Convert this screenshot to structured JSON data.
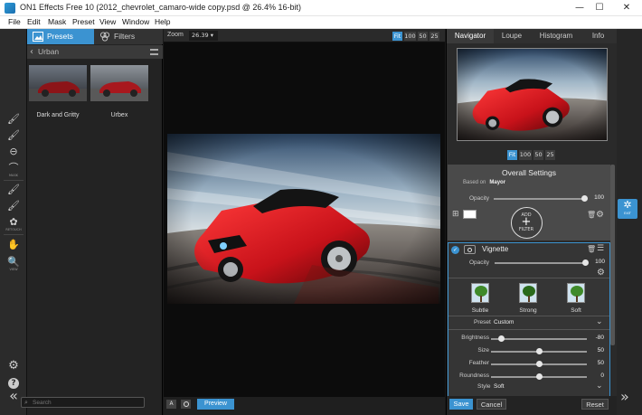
{
  "window": {
    "title": "ON1 Effects Free 10 (2012_chevrolet_camaro-wide copy.psd @ 26.4% 16-bit)",
    "minimize": "—",
    "maximize": "☐",
    "close": "✕"
  },
  "menu": [
    "File",
    "Edit",
    "Mask",
    "Preset",
    "View",
    "Window",
    "Help"
  ],
  "tools": [
    {
      "icon": "brush-icon",
      "glyph": "🖌",
      "caption": ""
    },
    {
      "icon": "brush-icon",
      "glyph": "🖌",
      "caption": ""
    },
    {
      "icon": "refine-icon",
      "glyph": "⊖",
      "caption": ""
    },
    {
      "icon": "mask-icon",
      "glyph": "⌒",
      "caption": "MASK"
    },
    {
      "icon": "brush-icon",
      "glyph": "🖌",
      "caption": ""
    },
    {
      "icon": "brush-icon",
      "glyph": "🖌",
      "caption": ""
    },
    {
      "icon": "retouch-icon",
      "glyph": "✿",
      "caption": "RETOUCH"
    },
    {
      "icon": "hand-icon",
      "glyph": "✋",
      "caption": ""
    },
    {
      "icon": "zoom-icon",
      "glyph": "🔍",
      "caption": "VIEW"
    }
  ],
  "tools_bottom": {
    "settings": "⚙",
    "help": "?",
    "collapse": "«"
  },
  "browser": {
    "tab_presets": "Presets",
    "tab_filters": "Filters",
    "category": "Urban",
    "presets": [
      {
        "name": "Dark and Gritty"
      },
      {
        "name": "Urbex"
      }
    ],
    "search_placeholder": "Search"
  },
  "canvas": {
    "zoom_label": "Zoom",
    "zoom_value": "26.39",
    "zoom_buttons": [
      "Fit",
      "100",
      "50",
      "25"
    ],
    "preview_label": "Preview",
    "before_after": "A"
  },
  "right": {
    "tabs": [
      "Navigator",
      "Loupe",
      "Histogram",
      "Info"
    ],
    "nav_zoom_buttons": [
      "Fit",
      "100",
      "50",
      "25"
    ],
    "overall": {
      "title": "Overall Settings",
      "based_on_label": "Based on",
      "based_on_value": "Mayor",
      "opacity_label": "Opacity",
      "opacity_value": "100",
      "add_filter_top": "ADD",
      "add_filter_bottom": "FILTER"
    },
    "vignette": {
      "title": "Vignette",
      "opacity_label": "Opacity",
      "opacity_value": "100",
      "presets": [
        "Subtle",
        "Strong",
        "Soft"
      ],
      "preset_label": "Preset",
      "preset_value": "Custom",
      "sliders": [
        {
          "label": "Brightness",
          "value": "-80",
          "level": 0.1
        },
        {
          "label": "Size",
          "value": "50",
          "level": 0.5
        },
        {
          "label": "Feather",
          "value": "50",
          "level": 0.5
        },
        {
          "label": "Roundness",
          "value": "0",
          "level": 0.5
        }
      ],
      "style_label": "Style",
      "style_value": "Soft"
    },
    "save_label": "Save",
    "cancel_label": "Cancel",
    "reset_label": "Reset"
  },
  "rightstrip": {
    "export_caption": "EXIT",
    "expand": "»"
  },
  "colors": {
    "accent": "#3b93d1",
    "car_red": "#c8121a"
  }
}
